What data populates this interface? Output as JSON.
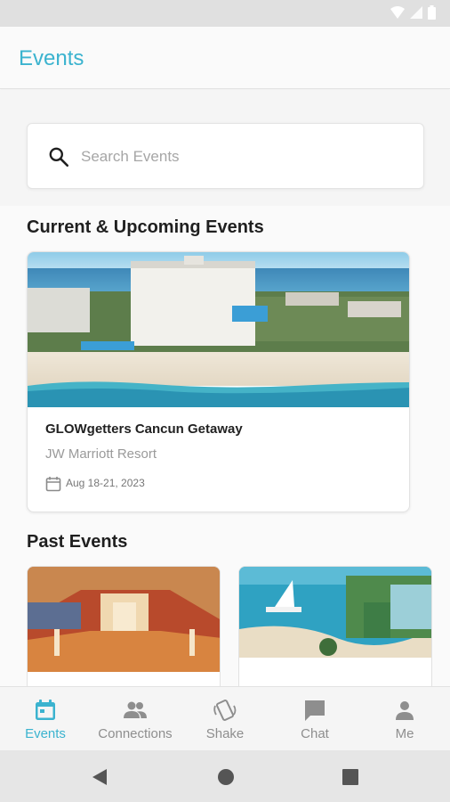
{
  "app": {
    "title": "Events"
  },
  "search": {
    "placeholder": "Search Events",
    "value": ""
  },
  "sections": {
    "current": "Current & Upcoming Events",
    "past": "Past Events"
  },
  "current_events": [
    {
      "name": "GLOWgetters Cancun Getaway",
      "venue": "JW Marriott Resort",
      "date": "Aug 18-21, 2023"
    }
  ],
  "bottom_nav": [
    {
      "label": "Events",
      "icon": "calendar-icon",
      "active": true
    },
    {
      "label": "Connections",
      "icon": "people-icon",
      "active": false
    },
    {
      "label": "Shake",
      "icon": "shake-phone-icon",
      "active": false
    },
    {
      "label": "Chat",
      "icon": "chat-bubble-icon",
      "active": false
    },
    {
      "label": "Me",
      "icon": "person-icon",
      "active": false
    }
  ],
  "colors": {
    "accent": "#3bb3cf",
    "inactive": "#8e8e8e",
    "background": "#fafafa"
  }
}
